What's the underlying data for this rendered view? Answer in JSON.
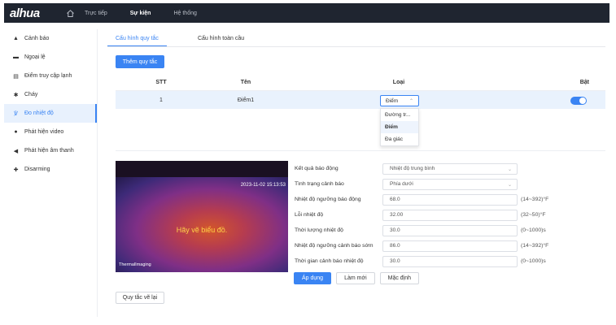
{
  "brand": {
    "logo": "alhua"
  },
  "topnav": [
    "Trực tiếp",
    "Sự kiện",
    "Hệ thống"
  ],
  "topnav_active": "Sự kiện",
  "sidebar": {
    "items": [
      {
        "label": "Cảnh báo",
        "icon": "alarm-icon"
      },
      {
        "label": "Ngoại lệ",
        "icon": "exception-icon"
      },
      {
        "label": "Điểm truy cập lạnh",
        "icon": "access-point-icon"
      },
      {
        "label": "Cháy",
        "icon": "fire-icon"
      },
      {
        "label": "Đo nhiệt độ",
        "icon": "thermometer-icon",
        "active": true
      },
      {
        "label": "Phát hiện video",
        "icon": "video-detect-icon"
      },
      {
        "label": "Phát hiện âm thanh",
        "icon": "audio-detect-icon"
      },
      {
        "label": "Disarming",
        "icon": "disarming-icon"
      }
    ]
  },
  "tabs": [
    "Cấu hình quy tắc",
    "Cấu hình toàn cầu"
  ],
  "add_rule_button": "Thêm quy tắc",
  "table": {
    "headers": {
      "stt": "STT",
      "name": "Tên",
      "type": "Loại",
      "enable": "Bật"
    },
    "rows": [
      {
        "stt": "1",
        "name": "Điểm1",
        "type": "Điểm",
        "enabled": true
      }
    ]
  },
  "type_dropdown": {
    "options": [
      "Đường tr...",
      "Điểm",
      "Đa giác"
    ],
    "selected": "Điểm"
  },
  "preview": {
    "timestamp": "2023-11-02 15:13:53",
    "hint": "Hãy vẽ biểu đồ.",
    "camera_label": "ThermalImaging"
  },
  "redraw_button": "Quy tắc vẽ lại",
  "form": {
    "rows": [
      {
        "label": "Kết quả báo động",
        "value": "Nhiệt độ trung bình",
        "select": true,
        "hint": ""
      },
      {
        "label": "Tình trạng cảnh báo",
        "value": "Phía dưới",
        "select": true,
        "hint": ""
      },
      {
        "label": "Nhiệt độ ngưỡng báo động",
        "value": "68.0",
        "select": false,
        "hint": "(14~392)°F"
      },
      {
        "label": "Lỗi nhiệt độ",
        "value": "32.00",
        "select": false,
        "hint": "(32~50)°F"
      },
      {
        "label": "Thời lượng nhiệt độ",
        "value": "30.0",
        "select": false,
        "hint": "(0~1000)s"
      },
      {
        "label": "Nhiệt độ ngưỡng cảnh báo sớm",
        "value": "86.0",
        "select": false,
        "hint": "(14~392)°F"
      },
      {
        "label": "Thời gian cảnh báo nhiệt độ",
        "value": "30.0",
        "select": false,
        "hint": "(0~1000)s"
      }
    ]
  },
  "actions": {
    "apply": "Áp dụng",
    "refresh": "Làm mới",
    "default": "Mặc định"
  },
  "colors": {
    "accent": "#3a84f3",
    "topbar": "#1f2530"
  }
}
